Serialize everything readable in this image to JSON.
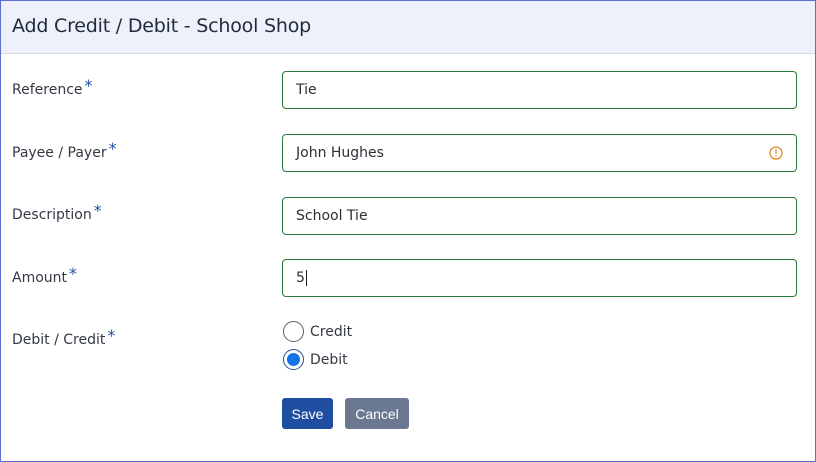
{
  "header": {
    "title": "Add Credit / Debit - School Shop"
  },
  "form": {
    "required_marker": "*",
    "reference": {
      "label": "Reference",
      "value": "Tie"
    },
    "payee": {
      "label": "Payee / Payer",
      "value": "John Hughes"
    },
    "description": {
      "label": "Description",
      "value": "School Tie"
    },
    "amount": {
      "label": "Amount",
      "value": "5"
    },
    "type": {
      "label": "Debit / Credit",
      "options": [
        {
          "label": "Credit",
          "selected": false
        },
        {
          "label": "Debit",
          "selected": true
        }
      ]
    }
  },
  "buttons": {
    "save": "Save",
    "cancel": "Cancel"
  },
  "colors": {
    "primary": "#1f4ea1",
    "secondary": "#6a7891",
    "input_border": "#2c7a3c",
    "warning": "#e08a1e",
    "radio_selected": "#1473e6"
  },
  "icons": {
    "payee_info": "info-circle-icon"
  }
}
